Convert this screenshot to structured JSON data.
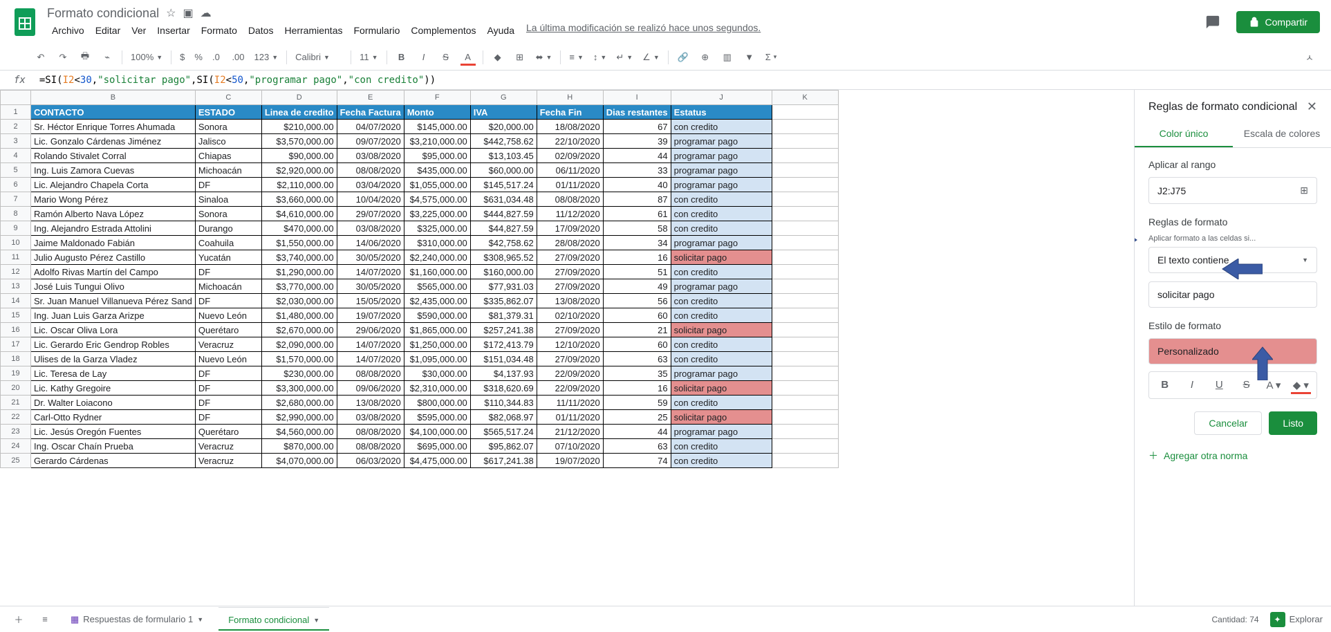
{
  "title": "Formato condicional",
  "menus": [
    "Archivo",
    "Editar",
    "Ver",
    "Insertar",
    "Formato",
    "Datos",
    "Herramientas",
    "Formulario",
    "Complementos",
    "Ayuda"
  ],
  "last_modified": "La última modificación se realizó hace unos segundos.",
  "share": "Compartir",
  "toolbar": {
    "zoom": "100%",
    "currency": "$",
    "percent": "%",
    "dec_dec": ".0",
    "dec_inc": ".00",
    "numfmt": "123",
    "font": "Calibri",
    "size": "11"
  },
  "formula": {
    "eq": "=",
    "fn": "SI",
    "p_o": "(",
    "ref": "I2",
    "lt": "<",
    "n1": "30",
    "c": ",",
    "s1": "\"solicitar pago\"",
    "fn2": "SI",
    "ref2": "I2",
    "n2": "50",
    "s2": "\"programar pago\"",
    "s3": "\"con credito\"",
    "p_c": ")"
  },
  "columns": [
    "",
    "B",
    "C",
    "D",
    "E",
    "F",
    "G",
    "H",
    "I",
    "J",
    "K"
  ],
  "headers": [
    "CONTACTO",
    "ESTADO",
    "Linea de credito",
    "Fecha Factura",
    "Monto",
    "IVA",
    "Fecha Fin",
    "Dias restantes",
    "Estatus"
  ],
  "rows": [
    {
      "n": 1
    },
    {
      "n": 2,
      "c": [
        "Sr. Héctor Enrique Torres Ahumada",
        "Sonora",
        "$210,000.00",
        "04/07/2020",
        "$145,000.00",
        "$20,000.00",
        "18/08/2020",
        "67",
        "con credito"
      ],
      "s": "cc"
    },
    {
      "n": 3,
      "c": [
        "Lic. Gonzalo Cárdenas Jiménez",
        "Jalisco",
        "$3,570,000.00",
        "09/07/2020",
        "$3,210,000.00",
        "$442,758.62",
        "22/10/2020",
        "39",
        "programar pago"
      ],
      "s": "pp"
    },
    {
      "n": 4,
      "c": [
        "Rolando Stivalet Corral",
        "Chiapas",
        "$90,000.00",
        "03/08/2020",
        "$95,000.00",
        "$13,103.45",
        "02/09/2020",
        "44",
        "programar pago"
      ],
      "s": "pp"
    },
    {
      "n": 5,
      "c": [
        "Ing. Luis Zamora Cuevas",
        "Michoacán",
        "$2,920,000.00",
        "08/08/2020",
        "$435,000.00",
        "$60,000.00",
        "06/11/2020",
        "33",
        "programar pago"
      ],
      "s": "pp"
    },
    {
      "n": 6,
      "c": [
        "Lic. Alejandro Chapela Corta",
        "DF",
        "$2,110,000.00",
        "03/04/2020",
        "$1,055,000.00",
        "$145,517.24",
        "01/11/2020",
        "40",
        "programar pago"
      ],
      "s": "pp"
    },
    {
      "n": 7,
      "c": [
        "Mario Wong Pérez",
        "Sinaloa",
        "$3,660,000.00",
        "10/04/2020",
        "$4,575,000.00",
        "$631,034.48",
        "08/08/2020",
        "87",
        "con credito"
      ],
      "s": "cc"
    },
    {
      "n": 8,
      "c": [
        "Ramón Alberto Nava López",
        "Sonora",
        "$4,610,000.00",
        "29/07/2020",
        "$3,225,000.00",
        "$444,827.59",
        "11/12/2020",
        "61",
        "con credito"
      ],
      "s": "cc"
    },
    {
      "n": 9,
      "c": [
        "Ing. Alejandro Estrada Attolini",
        "Durango",
        "$470,000.00",
        "03/08/2020",
        "$325,000.00",
        "$44,827.59",
        "17/09/2020",
        "58",
        "con credito"
      ],
      "s": "cc"
    },
    {
      "n": 10,
      "c": [
        "Jaime Maldonado Fabián",
        "Coahuila",
        "$1,550,000.00",
        "14/06/2020",
        "$310,000.00",
        "$42,758.62",
        "28/08/2020",
        "34",
        "programar pago"
      ],
      "s": "pp"
    },
    {
      "n": 11,
      "c": [
        "Julio Augusto Pérez Castillo",
        "Yucatán",
        "$3,740,000.00",
        "30/05/2020",
        "$2,240,000.00",
        "$308,965.52",
        "27/09/2020",
        "16",
        "solicitar pago"
      ],
      "s": "sp"
    },
    {
      "n": 12,
      "c": [
        "Adolfo Rivas Martín del Campo",
        "DF",
        "$1,290,000.00",
        "14/07/2020",
        "$1,160,000.00",
        "$160,000.00",
        "27/09/2020",
        "51",
        "con credito"
      ],
      "s": "cc"
    },
    {
      "n": 13,
      "c": [
        "José Luis Tungui Olivo",
        "Michoacán",
        "$3,770,000.00",
        "30/05/2020",
        "$565,000.00",
        "$77,931.03",
        "27/09/2020",
        "49",
        "programar pago"
      ],
      "s": "pp"
    },
    {
      "n": 14,
      "c": [
        "Sr. Juan Manuel Villanueva Pérez Sand",
        "DF",
        "$2,030,000.00",
        "15/05/2020",
        "$2,435,000.00",
        "$335,862.07",
        "13/08/2020",
        "56",
        "con credito"
      ],
      "s": "cc"
    },
    {
      "n": 15,
      "c": [
        "Ing. Juan Luis Garza Arizpe",
        "Nuevo León",
        "$1,480,000.00",
        "19/07/2020",
        "$590,000.00",
        "$81,379.31",
        "02/10/2020",
        "60",
        "con credito"
      ],
      "s": "cc"
    },
    {
      "n": 16,
      "c": [
        "Lic. Oscar Oliva Lora",
        "Querétaro",
        "$2,670,000.00",
        "29/06/2020",
        "$1,865,000.00",
        "$257,241.38",
        "27/09/2020",
        "21",
        "solicitar pago"
      ],
      "s": "sp"
    },
    {
      "n": 17,
      "c": [
        "Lic. Gerardo Eric Gendrop Robles",
        "Veracruz",
        "$2,090,000.00",
        "14/07/2020",
        "$1,250,000.00",
        "$172,413.79",
        "12/10/2020",
        "60",
        "con credito"
      ],
      "s": "cc"
    },
    {
      "n": 18,
      "c": [
        "Ulises de la Garza Vladez",
        "Nuevo León",
        "$1,570,000.00",
        "14/07/2020",
        "$1,095,000.00",
        "$151,034.48",
        "27/09/2020",
        "63",
        "con credito"
      ],
      "s": "cc"
    },
    {
      "n": 19,
      "c": [
        "Lic. Teresa de Lay",
        "DF",
        "$230,000.00",
        "08/08/2020",
        "$30,000.00",
        "$4,137.93",
        "22/09/2020",
        "35",
        "programar pago"
      ],
      "s": "pp"
    },
    {
      "n": 20,
      "c": [
        "Lic. Kathy Gregoire",
        "DF",
        "$3,300,000.00",
        "09/06/2020",
        "$2,310,000.00",
        "$318,620.69",
        "22/09/2020",
        "16",
        "solicitar pago"
      ],
      "s": "sp"
    },
    {
      "n": 21,
      "c": [
        "Dr. Walter Loiacono",
        "DF",
        "$2,680,000.00",
        "13/08/2020",
        "$800,000.00",
        "$110,344.83",
        "11/11/2020",
        "59",
        "con credito"
      ],
      "s": "cc"
    },
    {
      "n": 22,
      "c": [
        "Carl-Otto Rydner",
        "DF",
        "$2,990,000.00",
        "03/08/2020",
        "$595,000.00",
        "$82,068.97",
        "01/11/2020",
        "25",
        "solicitar pago"
      ],
      "s": "sp"
    },
    {
      "n": 23,
      "c": [
        "Lic. Jesús Oregón Fuentes",
        "Querétaro",
        "$4,560,000.00",
        "08/08/2020",
        "$4,100,000.00",
        "$565,517.24",
        "21/12/2020",
        "44",
        "programar pago"
      ],
      "s": "pp"
    },
    {
      "n": 24,
      "c": [
        "Ing. Oscar Chaín Prueba",
        "Veracruz",
        "$870,000.00",
        "08/08/2020",
        "$695,000.00",
        "$95,862.07",
        "07/10/2020",
        "63",
        "con credito"
      ],
      "s": "cc"
    },
    {
      "n": 25,
      "c": [
        "Gerardo Cárdenas",
        "Veracruz",
        "$4,070,000.00",
        "06/03/2020",
        "$4,475,000.00",
        "$617,241.38",
        "19/07/2020",
        "74",
        "con credito"
      ],
      "s": "cc"
    }
  ],
  "panel": {
    "title": "Reglas de formato condicional",
    "tab1": "Color único",
    "tab2": "Escala de colores",
    "apply_range_label": "Aplicar al rango",
    "range": "J2:J75",
    "rules_label": "Reglas de formato",
    "if_label": "Aplicar formato a las celdas si...",
    "condition": "El texto contiene",
    "value": "solicitar pago",
    "style_label": "Estilo de formato",
    "style_name": "Personalizado",
    "cancel": "Cancelar",
    "done": "Listo",
    "add": "Agregar otra norma"
  },
  "tabs": {
    "t1": "Respuestas de formulario 1",
    "t2": "Formato condicional"
  },
  "footer": {
    "count": "Cantidad: 74",
    "explore": "Explorar"
  }
}
